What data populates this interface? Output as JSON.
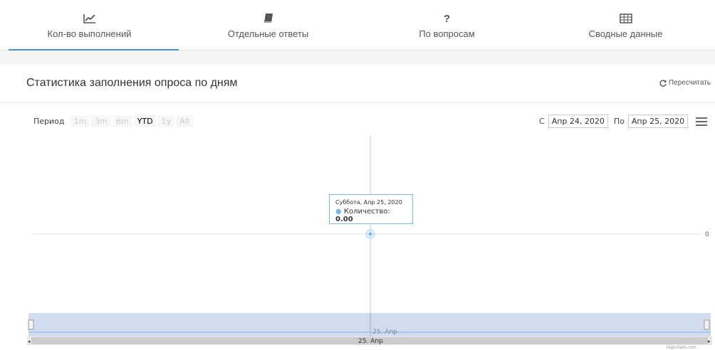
{
  "tabs": [
    {
      "label": "Кол-во выполнений",
      "icon": "line-chart-icon",
      "active": true
    },
    {
      "label": "Отдельные ответы",
      "icon": "book-icon",
      "active": false
    },
    {
      "label": "По вопросам",
      "icon": "question-icon",
      "active": false
    },
    {
      "label": "Сводные данные",
      "icon": "table-icon",
      "active": false
    }
  ],
  "panel": {
    "title": "Статистика заполнения опроса по дням",
    "recalc_label": "Пересчитать"
  },
  "range_selector": {
    "label": "Период",
    "buttons": [
      "1m",
      "3m",
      "6m",
      "YTD",
      "1y",
      "All"
    ],
    "selected": "YTD"
  },
  "date_range": {
    "from_label": "С",
    "from_value": "Апр 24, 2020",
    "to_label": "По",
    "to_value": "Апр 25, 2020"
  },
  "tooltip": {
    "date": "Суббота, Апр 25, 2020",
    "series_label": "Количество:",
    "value": "0.00"
  },
  "chart_data": {
    "type": "line",
    "x": [
      "2020-04-25"
    ],
    "series": [
      {
        "name": "Количество",
        "values": [
          0
        ]
      }
    ],
    "y_tick_labels": [
      "0"
    ],
    "navigator_labels": [
      "25. Апр",
      "25. Апр"
    ],
    "grid": true
  },
  "colors": {
    "accent": "#4a90d9",
    "series": "#7cb5ec",
    "navigator_mask": "#c6d3ee"
  },
  "credits": "Highcharts.com"
}
